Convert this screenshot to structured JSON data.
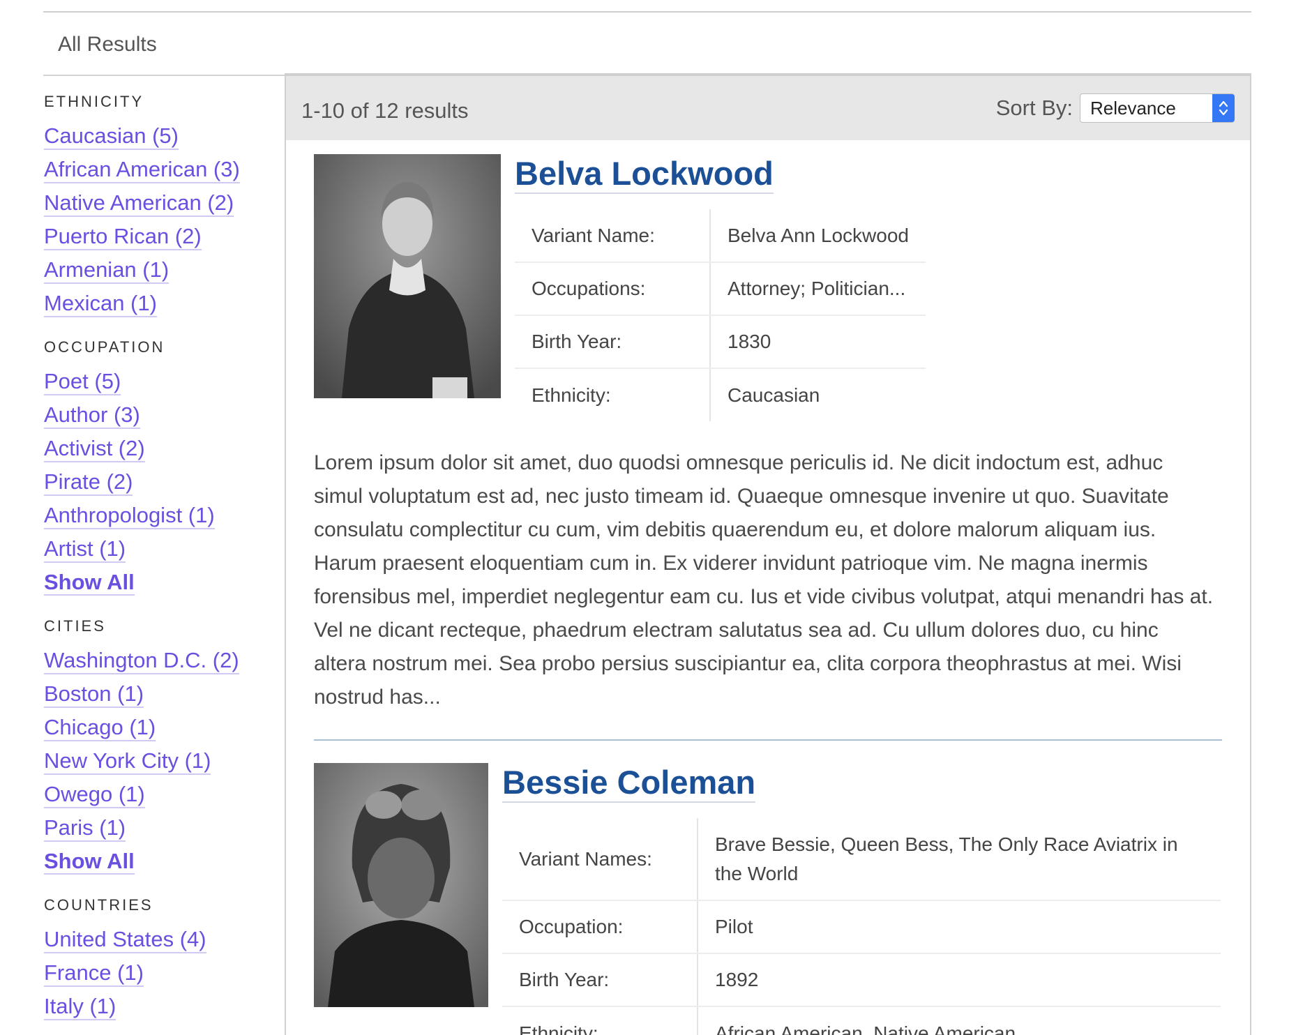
{
  "breadcrumb": {
    "label": "All Results"
  },
  "facets": [
    {
      "title": "ETHNICITY",
      "items": [
        "Caucasian (5)",
        "African American (3)",
        "Native American (2)",
        "Puerto Rican (2)",
        "Armenian (1)",
        "Mexican (1)"
      ]
    },
    {
      "title": "OCCUPATION",
      "items": [
        "Poet (5)",
        "Author (3)",
        "Activist (2)",
        "Pirate (2)",
        "Anthropologist (1)",
        "Artist (1)"
      ],
      "show_all": "Show All"
    },
    {
      "title": "CITIES",
      "items": [
        "Washington D.C. (2)",
        "Boston (1)",
        "Chicago (1)",
        "New York City (1)",
        "Owego (1)",
        "Paris (1)"
      ],
      "show_all": "Show All"
    },
    {
      "title": "COUNTRIES",
      "items": [
        "United States (4)",
        "France (1)",
        "Italy (1)"
      ]
    }
  ],
  "results_bar": {
    "count": "1-10 of 12 results",
    "sort_label": "Sort By:",
    "sort_value": "Relevance"
  },
  "results": [
    {
      "name": "Belva Lockwood",
      "fields": [
        {
          "label": "Variant Name:",
          "value": "Belva Ann Lockwood"
        },
        {
          "label": "Occupations:",
          "value": "Attorney; Politician..."
        },
        {
          "label": "Birth Year:",
          "value": "1830"
        },
        {
          "label": "Ethnicity:",
          "value": "Caucasian"
        }
      ],
      "description": "Lorem ipsum dolor sit amet, duo quodsi omnesque periculis id. Ne dicit indoctum est, adhuc simul voluptatum est ad, nec justo timeam id. Quaeque omnesque invenire ut quo. Suavitate consulatu complectitur cu cum, vim debitis quaerendum eu, et dolore malorum aliquam ius. Harum praesent eloquentiam cum in. Ex viderer invidunt patrioque vim. Ne magna inermis forensibus mel, imperdiet neglegentur eam cu. Ius et vide civibus volutpat, atqui menandri has at. Vel ne dicant recteque, phaedrum electram salutatus sea ad. Cu ullum dolores duo, cu hinc altera nostrum mei. Sea probo persius suscipiantur ea, clita corpora theophrastus at mei. Wisi nostrud has..."
    },
    {
      "name": "Bessie Coleman",
      "fields": [
        {
          "label": "Variant Names:",
          "value": "Brave Bessie, Queen Bess, The Only Race Aviatrix in the World"
        },
        {
          "label": "Occupation:",
          "value": "Pilot"
        },
        {
          "label": "Birth Year:",
          "value": "1892"
        },
        {
          "label": "Ethnicity:",
          "value": "African American, Native American"
        }
      ]
    }
  ]
}
